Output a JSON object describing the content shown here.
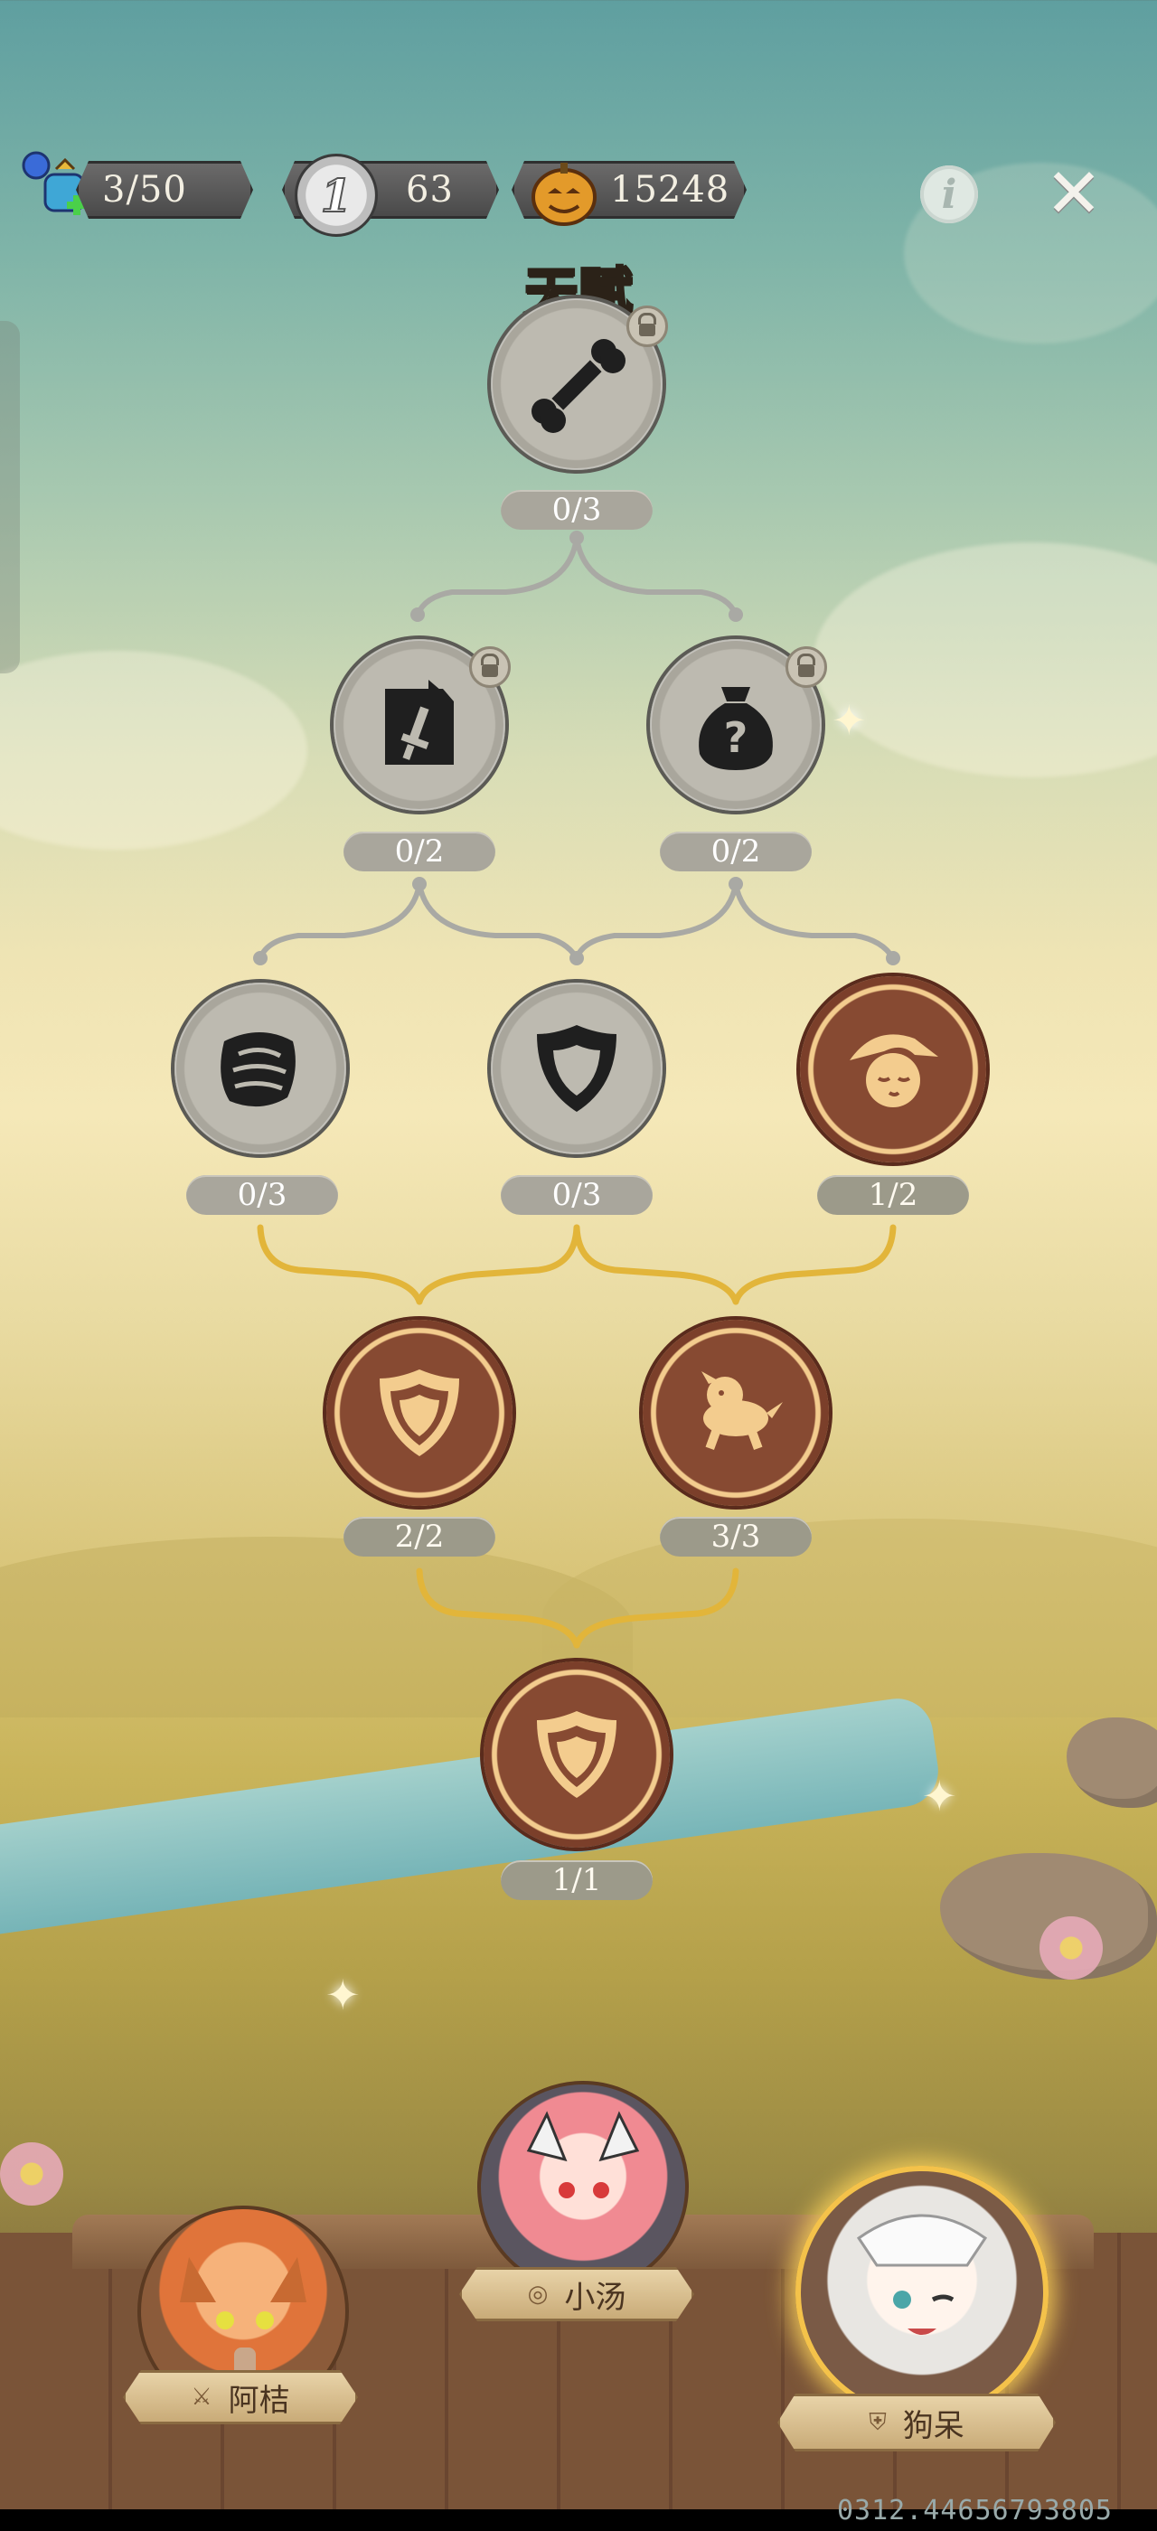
{
  "hud": {
    "energy": "3/50",
    "silver_coin": "63",
    "silver_coin_badge": "1",
    "pumpkin_coin": "15248"
  },
  "title": "天赋",
  "talent_nodes": [
    {
      "icon": "bone-icon",
      "progress": "0/3",
      "locked": true
    },
    {
      "icon": "sword-card-icon",
      "progress": "0/2",
      "locked": true
    },
    {
      "icon": "mystery-bag-icon",
      "progress": "0/2",
      "locked": true
    },
    {
      "icon": "meat-roll-icon",
      "progress": "0/3",
      "locked": false
    },
    {
      "icon": "shield-icon",
      "progress": "0/3",
      "locked": false
    },
    {
      "icon": "sleeping-girl-icon",
      "progress": "1/2",
      "locked": false
    },
    {
      "icon": "shield-icon",
      "progress": "2/2",
      "locked": false
    },
    {
      "icon": "running-dog-icon",
      "progress": "3/3",
      "locked": false
    },
    {
      "icon": "shield-icon",
      "progress": "1/1",
      "locked": false
    }
  ],
  "characters": [
    {
      "name": "阿桔",
      "role_icon": "sword-icon",
      "selected": false
    },
    {
      "name": "小汤",
      "role_icon": "target-icon",
      "selected": false
    },
    {
      "name": "狗呆",
      "role_icon": "shield-icon",
      "selected": true
    }
  ],
  "debug_stamp": "0312.44656793805",
  "colors": {
    "active_line": "#e2b53a",
    "locked_line": "#a9a9a4",
    "active_node": "#7b3f2a"
  }
}
